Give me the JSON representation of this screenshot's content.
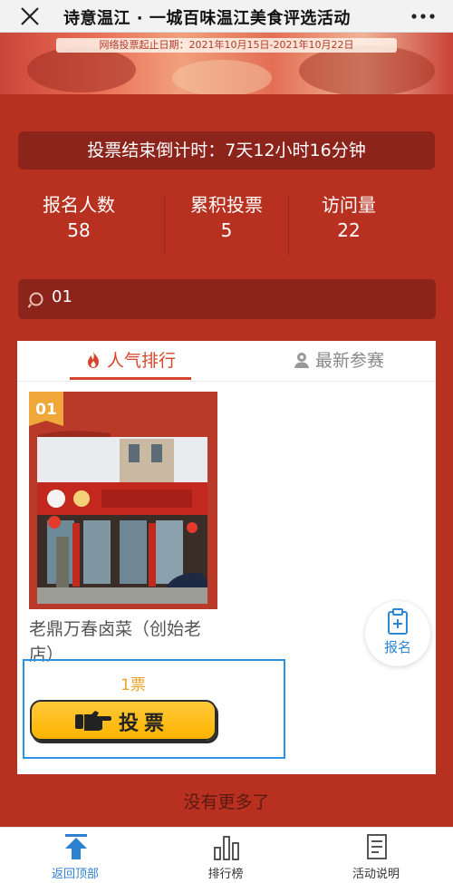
{
  "header": {
    "title": "诗意温江 · 一城百味温江美食评选活动"
  },
  "banner": {
    "dateline": "网络投票起止日期：2021年10月15日-2021年10月22日"
  },
  "countdown": {
    "text": "投票结束倒计时：7天12小时16分钟"
  },
  "stats": [
    {
      "label": "报名人数",
      "value": "58"
    },
    {
      "label": "累积投票",
      "value": "5"
    },
    {
      "label": "访问量",
      "value": "22"
    }
  ],
  "search": {
    "value": "01"
  },
  "tabs": [
    {
      "label": "人气排行",
      "icon": "flame-icon",
      "active": true
    },
    {
      "label": "最新参赛",
      "icon": "person-icon",
      "active": false
    }
  ],
  "entries": [
    {
      "rank": "01",
      "name": "老鼎万春卤菜（创始老店）",
      "votes": "1票",
      "vote_button": "投票"
    }
  ],
  "float_button": {
    "label": "报名"
  },
  "list_end": "没有更多了",
  "bottom_nav": [
    {
      "label": "返回顶部",
      "icon": "arrow-up-icon"
    },
    {
      "label": "排行榜",
      "icon": "bar-chart-icon"
    },
    {
      "label": "活动说明",
      "icon": "document-icon"
    }
  ],
  "colors": {
    "page_bg": "#b8301f",
    "accent_red": "#d6452b",
    "vote_yellow": "#ffb400",
    "link_blue": "#2e80d0"
  }
}
